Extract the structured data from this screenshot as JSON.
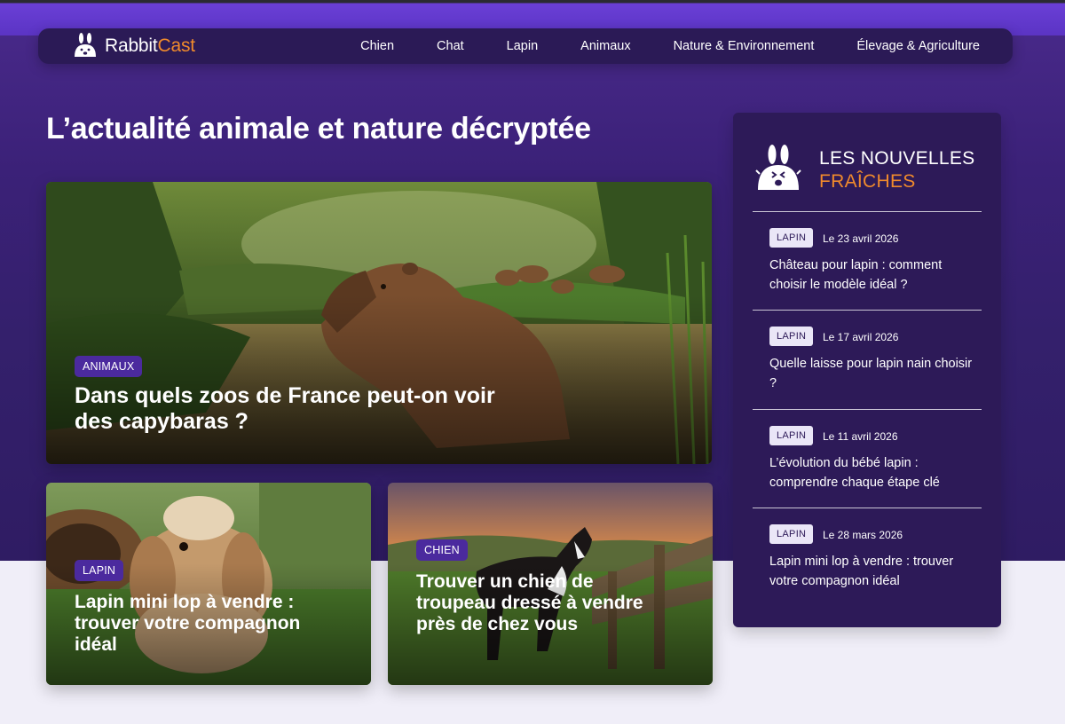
{
  "brand": {
    "name_part1": "Rabbit",
    "name_part2": "Cast",
    "accent_color": "#f08a2c",
    "primary_color": "#4b2a9e"
  },
  "nav": {
    "items": [
      {
        "label": "Chien"
      },
      {
        "label": "Chat"
      },
      {
        "label": "Lapin"
      },
      {
        "label": "Animaux"
      },
      {
        "label": "Nature & Environnement"
      },
      {
        "label": "Élevage & Agriculture"
      }
    ]
  },
  "page": {
    "title": "L’actualité animale et nature décryptée"
  },
  "featured": {
    "main": {
      "category": "ANIMAUX",
      "title": "Dans quels zoos de France peut-on voir des capybaras ?",
      "image": "capybara-in-jungle-pond"
    },
    "secondary": [
      {
        "category": "LAPIN",
        "title": "Lapin mini lop à vendre : trouver votre compagnon idéal",
        "image": "lop-rabbit-in-grass"
      },
      {
        "category": "CHIEN",
        "title": "Trouver un chien de troupeau dressé à vendre près de chez vous",
        "image": "border-collie-at-sunset-fence"
      }
    ]
  },
  "sidebar": {
    "title_line1": "LES NOUVELLES",
    "title_line2": "FRAÎCHES",
    "icon": "rabbit-mascot-icon",
    "items": [
      {
        "category": "LAPIN",
        "date": "Le 23 avril 2026",
        "title": "Château pour lapin : comment choisir le modèle idéal ?"
      },
      {
        "category": "LAPIN",
        "date": "Le 17 avril 2026",
        "title": "Quelle laisse pour lapin nain choisir ?"
      },
      {
        "category": "LAPIN",
        "date": "Le 11 avril 2026",
        "title": "L’évolution du bébé lapin : comprendre chaque étape clé"
      },
      {
        "category": "LAPIN",
        "date": "Le 28 mars 2026",
        "title": "Lapin mini lop à vendre : trouver votre compagnon idéal"
      }
    ]
  }
}
